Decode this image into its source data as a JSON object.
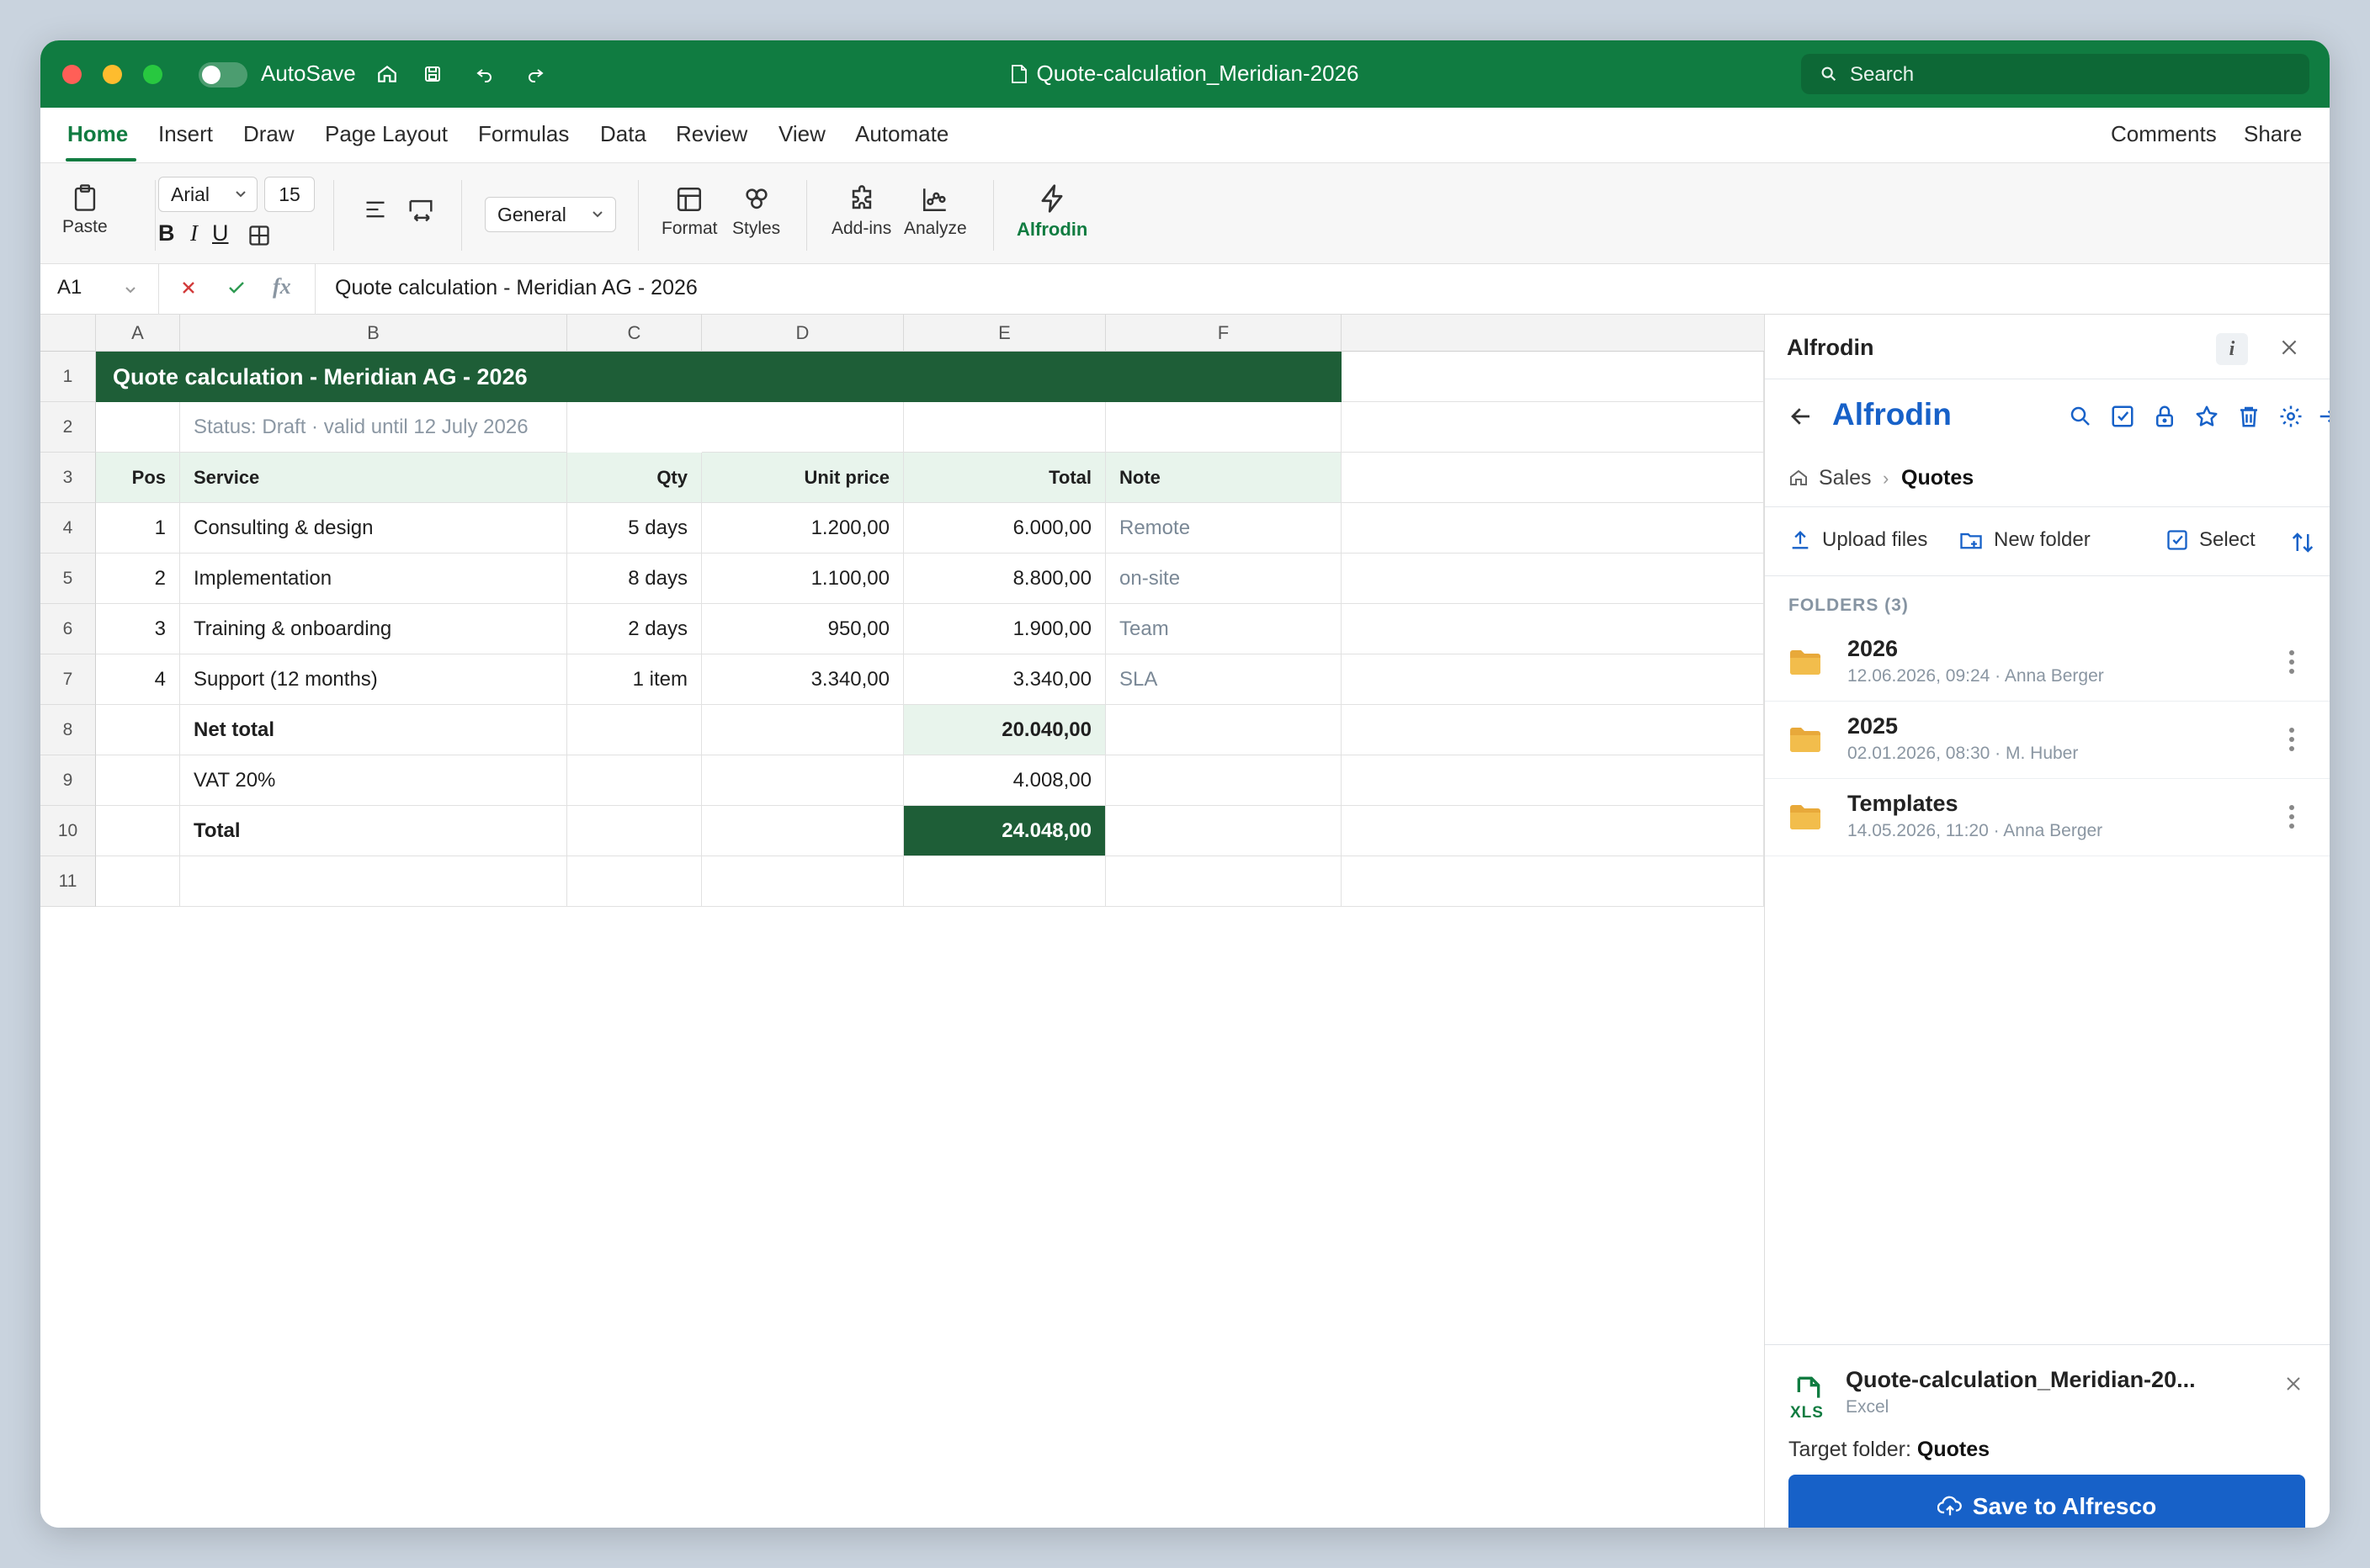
{
  "titlebar": {
    "autosave_label": "AutoSave",
    "document_title": "Quote-calculation_Meridian-2026",
    "search_placeholder": "Search"
  },
  "menu": {
    "items": [
      "Home",
      "Insert",
      "Draw",
      "Page Layout",
      "Formulas",
      "Data",
      "Review",
      "View",
      "Automate"
    ],
    "active": "Home",
    "comments": "Comments",
    "share": "Share"
  },
  "ribbon": {
    "paste": "Paste",
    "font_name": "Arial",
    "font_size": "15",
    "bold": "B",
    "italic": "I",
    "underline": "U",
    "number_format": "General",
    "format": "Format",
    "styles": "Styles",
    "addins": "Add-ins",
    "analyze": "Analyze",
    "alfrodin": "Alfrodin"
  },
  "formulabar": {
    "cell_ref": "A1",
    "fx": "fx",
    "content": "Quote calculation - Meridian AG - 2026"
  },
  "sheet": {
    "columns": [
      "A",
      "B",
      "C",
      "D",
      "E",
      "F"
    ],
    "rows": [
      "1",
      "2",
      "3",
      "4",
      "5",
      "6",
      "7",
      "8",
      "9",
      "10",
      "11"
    ],
    "title": "Quote calculation - Meridian AG - 2026",
    "status": "Status: Draft · valid until 12 July 2026",
    "headers": [
      "Pos",
      "Service",
      "Qty",
      "Unit price",
      "Total",
      "Note"
    ],
    "items": [
      {
        "pos": "1",
        "service": "Consulting & design",
        "qty": "5 days",
        "unit": "1.200,00",
        "total": "6.000,00",
        "note": "Remote"
      },
      {
        "pos": "2",
        "service": "Implementation",
        "qty": "8 days",
        "unit": "1.100,00",
        "total": "8.800,00",
        "note": "on-site"
      },
      {
        "pos": "3",
        "service": "Training & onboarding",
        "qty": "2 days",
        "unit": "950,00",
        "total": "1.900,00",
        "note": "Team"
      },
      {
        "pos": "4",
        "service": "Support (12 months)",
        "qty": "1 item",
        "unit": "3.340,00",
        "total": "3.340,00",
        "note": "SLA"
      }
    ],
    "net_label": "Net total",
    "net_value": "20.040,00",
    "vat_label": "VAT 20%",
    "vat_value": "4.008,00",
    "total_label": "Total",
    "total_value": "24.048,00",
    "colors": {
      "title_band": "#1e5e37",
      "header_fill": "#e8f4ec",
      "total_fill": "#1e5e37"
    }
  },
  "panel": {
    "title": "Alfrodin",
    "info": "i",
    "brand": "Alfrodin",
    "breadcrumb": [
      "Sales",
      "Quotes"
    ],
    "actions": {
      "upload": "Upload files",
      "new_folder": "New folder",
      "select": "Select"
    },
    "folders_label": "FOLDERS (3)",
    "folders": [
      {
        "name": "2026",
        "meta": "12.06.2026, 09:24 · Anna Berger"
      },
      {
        "name": "2025",
        "meta": "02.01.2026, 08:30 · M. Huber"
      },
      {
        "name": "Templates",
        "meta": "14.05.2026, 11:20 · Anna Berger"
      }
    ],
    "save": {
      "file_name": "Quote-calculation_Meridian-20...",
      "file_type": "Excel",
      "file_badge": "XLS",
      "target_label": "Target folder:",
      "target_folder": "Quotes",
      "button": "Save to Alfresco"
    },
    "accent": "#1761c8"
  }
}
